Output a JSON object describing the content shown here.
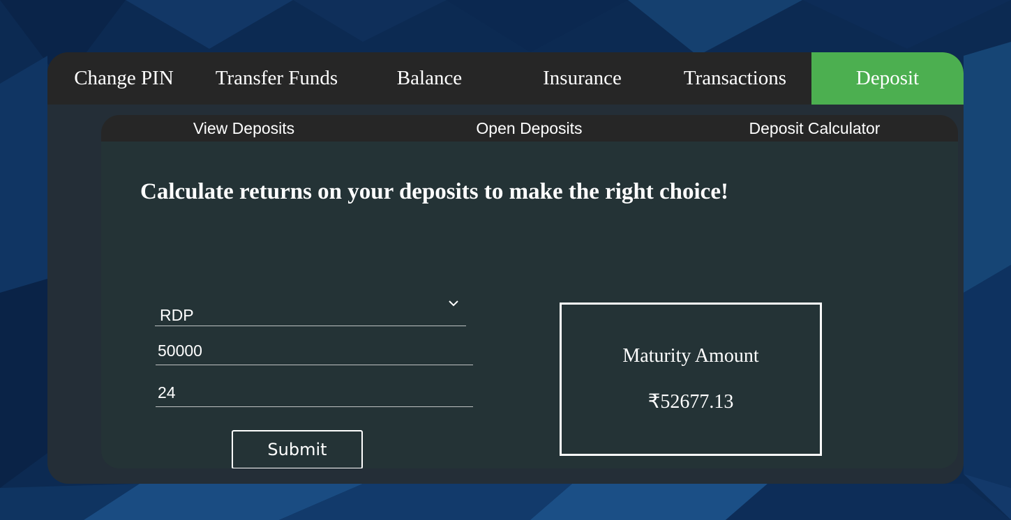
{
  "main_nav": {
    "tabs": [
      {
        "label": "Change PIN",
        "active": false
      },
      {
        "label": "Transfer Funds",
        "active": false
      },
      {
        "label": "Balance",
        "active": false
      },
      {
        "label": "Insurance",
        "active": false
      },
      {
        "label": "Transactions",
        "active": false
      },
      {
        "label": "Deposit",
        "active": true
      }
    ]
  },
  "sub_nav": {
    "tabs": [
      {
        "label": "View Deposits"
      },
      {
        "label": "Open Deposits"
      },
      {
        "label": "Deposit Calculator"
      }
    ]
  },
  "calculator": {
    "heading": "Calculate returns on your deposits to make the right choice!",
    "deposit_type": {
      "selected": "RDP",
      "icon": "chevron-down-icon"
    },
    "amount": {
      "value": "50000"
    },
    "months": {
      "value": "24"
    },
    "submit_label": "Submit"
  },
  "result": {
    "label": "Maturity Amount",
    "value": "₹52677.13"
  },
  "colors": {
    "active_tab": "#4caf50",
    "nav_bg": "#262626",
    "panel_bg": "#2b2f30",
    "background": "#0c2a52",
    "text": "#ffffff"
  }
}
